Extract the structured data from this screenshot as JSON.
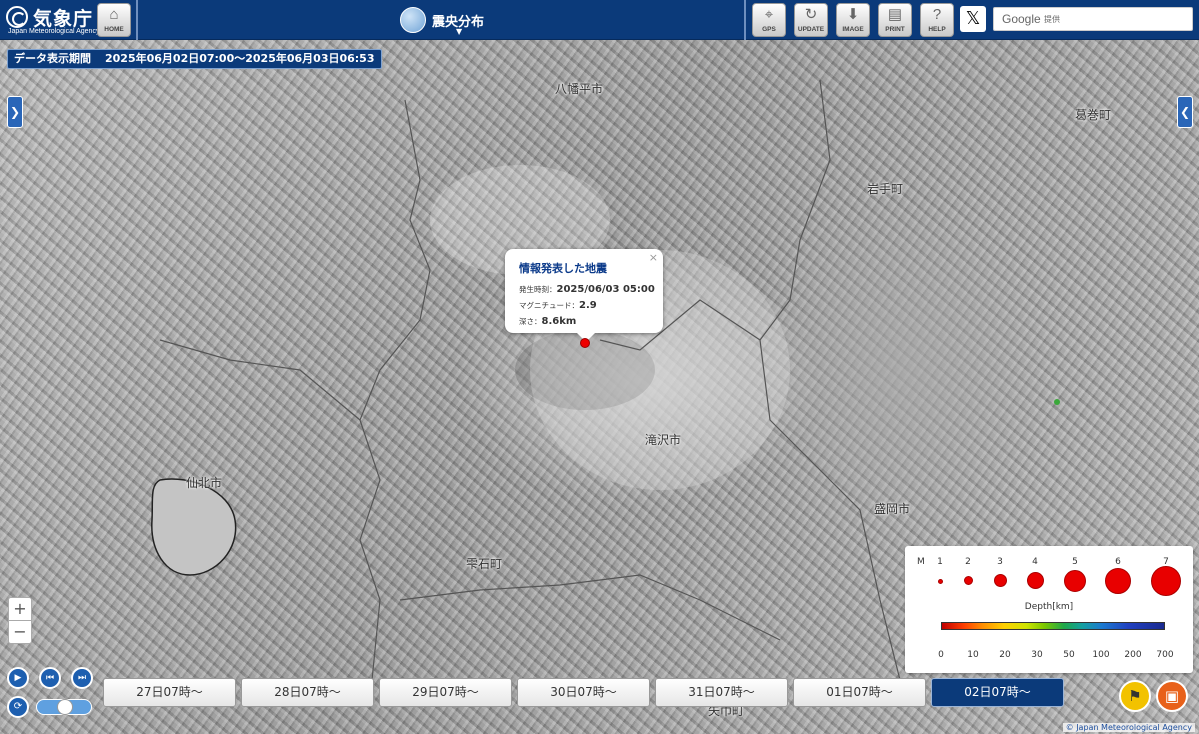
{
  "header": {
    "agency_name": "気象庁",
    "agency_name_en": "Japan Meteorological Agency",
    "home_label": "HOME",
    "map_title": "震央分布",
    "toolbar": [
      {
        "label": "GPS",
        "icon": "gps-icon"
      },
      {
        "label": "UPDATE",
        "icon": "refresh-icon"
      },
      {
        "label": "IMAGE",
        "icon": "download-icon"
      },
      {
        "label": "PRINT",
        "icon": "print-icon"
      },
      {
        "label": "HELP",
        "icon": "help-icon"
      }
    ],
    "share_icon": "x-logo-icon",
    "search": {
      "brand": "Google",
      "placeholder": "提供"
    }
  },
  "period": {
    "label": "データ表示期間",
    "range": "2025年06月02日07:00～2025年06月03日06:53"
  },
  "map_labels": [
    "八幡平市",
    "岩手町",
    "滝沢市",
    "仙北市",
    "雫石町",
    "盛岡市",
    "矢巾町",
    "葛巻町"
  ],
  "popup": {
    "title": "情報発表した地震",
    "rows": [
      {
        "key": "発生時刻：",
        "value": "2025/06/03 05:00"
      },
      {
        "key": "マグニチュード：",
        "value": "2.9"
      },
      {
        "key": "深さ：",
        "value": "8.6km"
      }
    ],
    "close_symbol": "×"
  },
  "zoom": {
    "in_label": "+",
    "out_label": "−"
  },
  "playback": {
    "speed_value": 0.5
  },
  "day_buttons": [
    "27日07時～",
    "28日07時～",
    "29日07時～",
    "30日07時～",
    "31日07時～",
    "01日07時～",
    "02日07時～"
  ],
  "active_day_index": 6,
  "legend": {
    "magnitude_label": "M",
    "magnitudes": [
      "1",
      "2",
      "3",
      "4",
      "5",
      "6",
      "7"
    ],
    "depth_title": "Depth[km]",
    "depth_ticks": [
      "0",
      "10",
      "20",
      "30",
      "50",
      "100",
      "200",
      "700"
    ],
    "marker_color": "#e80000"
  },
  "credit": "© Japan Meteorological Agency",
  "colors": {
    "header": "#0b3a7a",
    "accent": "#1d5fb0",
    "quake": "#e00000"
  }
}
